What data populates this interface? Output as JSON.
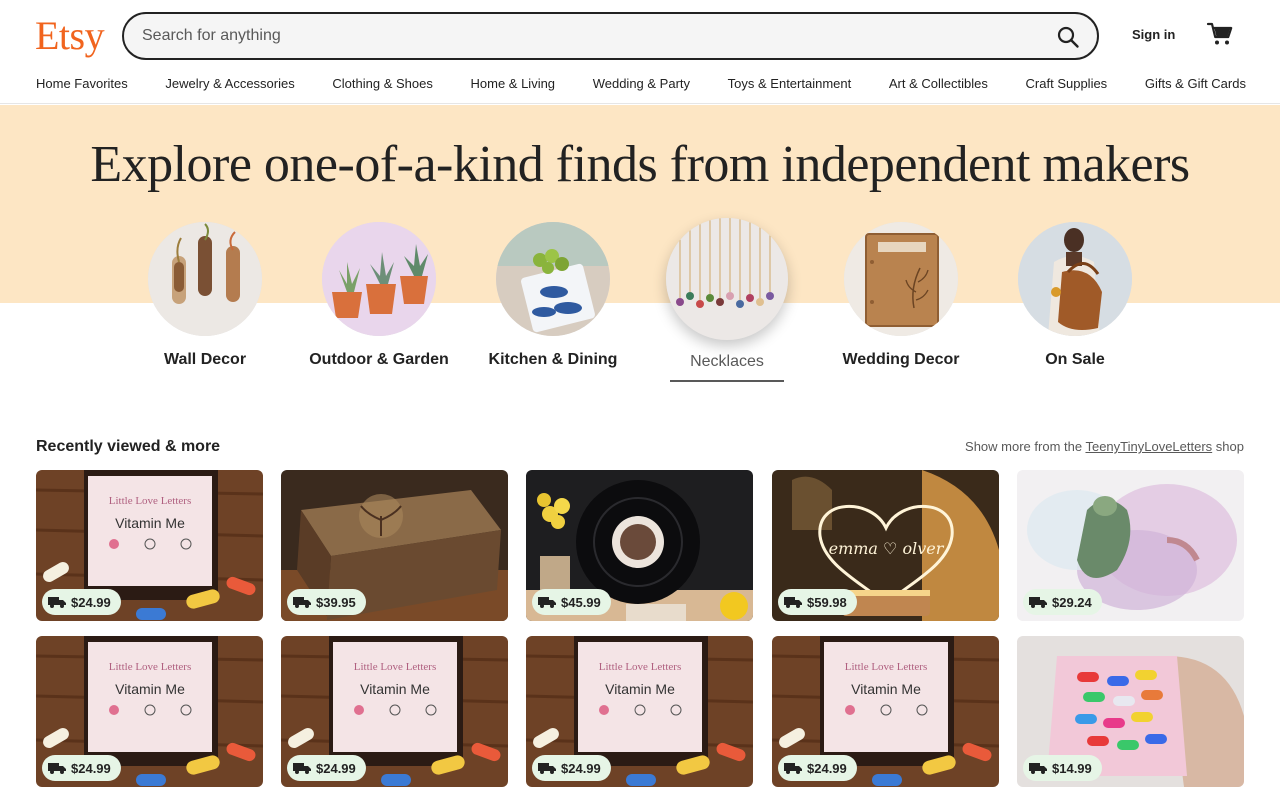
{
  "header": {
    "logo": "Etsy",
    "search_placeholder": "Search for anything",
    "sign_in": "Sign in"
  },
  "nav": [
    "Home Favorites",
    "Jewelry & Accessories",
    "Clothing & Shoes",
    "Home & Living",
    "Wedding & Party",
    "Toys & Entertainment",
    "Art & Collectibles",
    "Craft Supplies",
    "Gifts & Gift Cards"
  ],
  "hero": {
    "title": "Explore one-of-a-kind finds from independent makers"
  },
  "categories": [
    {
      "label": "Wall Decor"
    },
    {
      "label": "Outdoor & Garden"
    },
    {
      "label": "Kitchen & Dining"
    },
    {
      "label": "Necklaces",
      "active": true
    },
    {
      "label": "Wedding Decor"
    },
    {
      "label": "On Sale"
    }
  ],
  "recently_viewed": {
    "title": "Recently viewed & more",
    "more_prefix": "Show more from the",
    "shop_name": "TeenyTinyLoveLetters",
    "more_suffix": "shop",
    "items": [
      {
        "price": "$24.99",
        "image": "vitamin-me-jar"
      },
      {
        "price": "$39.95",
        "image": "wooden-keepsake-box"
      },
      {
        "price": "$45.99",
        "image": "vinyl-record-plaque"
      },
      {
        "price": "$59.98",
        "image": "heart-night-light"
      },
      {
        "price": "$29.24",
        "image": "watercolor-pet-portrait"
      },
      {
        "price": "$24.99",
        "image": "vitamin-me-jar"
      },
      {
        "price": "$24.99",
        "image": "vitamin-me-jar"
      },
      {
        "price": "$24.99",
        "image": "vitamin-me-jar"
      },
      {
        "price": "$24.99",
        "image": "vitamin-me-jar"
      },
      {
        "price": "$14.99",
        "image": "capsule-bag"
      }
    ]
  },
  "colors": {
    "brand": "#f1641e",
    "hero_bg": "#fde6c4",
    "price_badge_bg": "#e6f5e6"
  }
}
